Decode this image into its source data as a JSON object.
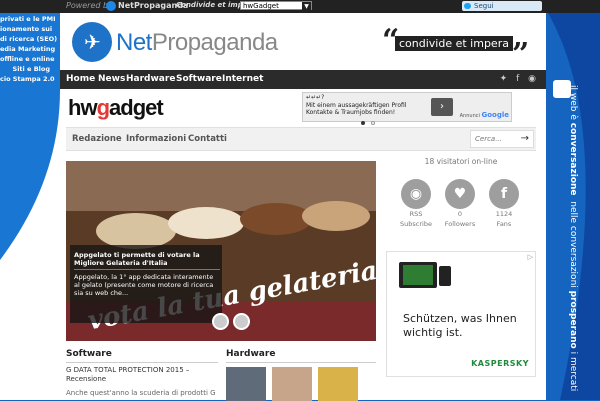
{
  "topbar": {
    "powered_by": "Powered by",
    "np_mini": "NetPropaganda",
    "tagline": "Condivide et impera",
    "site_select": "hwGadget",
    "follow": "Segui @netpropaganda"
  },
  "left_links": [
    "privati e le PMI",
    "ionamento sui",
    "di ricerca (SEO)",
    "edia Marketing",
    "offline e online",
    "Siti e Blog",
    "cio Stampa 2.0"
  ],
  "header": {
    "logo_net": "Net",
    "logo_propaganda": "Propaganda",
    "tagline": "condivide et impera"
  },
  "nav": {
    "items": [
      "Home",
      "News",
      "Hardware",
      "Software",
      "Internet"
    ]
  },
  "site": {
    "logo_hw": "hw",
    "logo_g": "g",
    "logo_adget": "adget"
  },
  "ad_top": {
    "title": "↵↵↵?",
    "text": "Mit einem aussagekräftigen Profil Kontakte & Traumjobs finden!",
    "label": "Annunci",
    "google": "Google"
  },
  "subnav": {
    "items": [
      "Redazione",
      "Informazioni",
      "Contatti"
    ],
    "search_placeholder": "Cerca..."
  },
  "slider": {
    "caption_title": "Appgelato ti permette di votare la Migliore Gelateria d'Italia",
    "caption_text": "Appgelato, la 1° app dedicata interamente al gelato (presente come motore di ricerca sia su web che...",
    "overlay": "vota la tua gelateria"
  },
  "sidebar": {
    "visitors": "18 visitatori on-line",
    "social": [
      {
        "icon": "rss-icon",
        "glyph": "◉",
        "label": "RSS",
        "count": "Subscribe"
      },
      {
        "icon": "twitter-icon",
        "glyph": "♥",
        "label": "0",
        "count": "Followers"
      },
      {
        "icon": "facebook-icon",
        "glyph": "f",
        "label": "1124",
        "count": "Fans"
      }
    ]
  },
  "ad_side": {
    "message": "Schützen, was Ihnen wichtig ist.",
    "brand": "KASPERSKY"
  },
  "sections": {
    "software": "Software",
    "hardware": "Hardware"
  },
  "article": {
    "title": "G DATA TOTAL PROTECTION 2015 – Recensione",
    "excerpt": "Anche quest'anno la scuderia di prodotti G"
  },
  "vertical": {
    "line1_a": "il web è ",
    "line1_b": "conversazione",
    "line2_a": "nelle conversazioni ",
    "line2_b": "prosperano",
    "line2_c": " i mercati"
  },
  "colors": {
    "brand_blue": "#1e73c8",
    "background_blue": "#1565c0",
    "nav_dark": "#2b2b2b"
  }
}
